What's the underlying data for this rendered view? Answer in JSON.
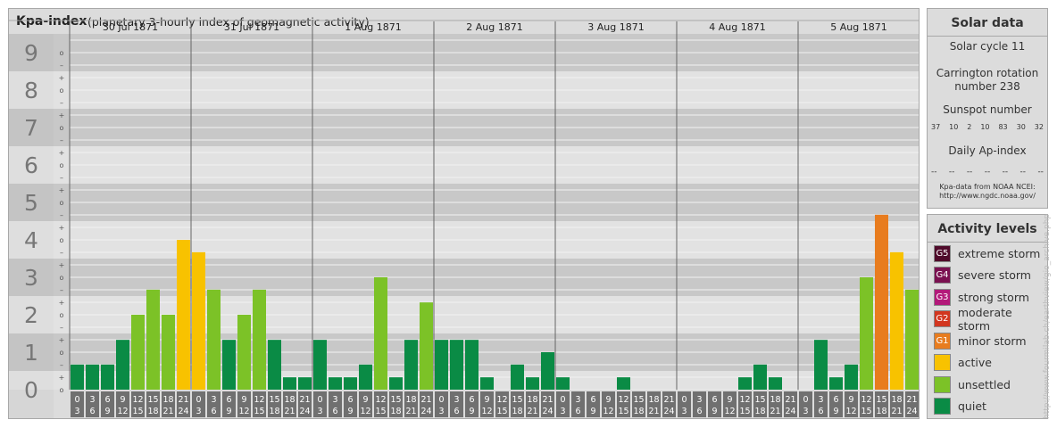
{
  "header": {
    "title": "Kpa-index",
    "subtitle": "(planetary 3-hourly index of geomagnetic activity)"
  },
  "solar": {
    "title": "Solar data",
    "cycle": "Solar cycle 11",
    "rotation_line1": "Carrington rotation",
    "rotation_line2": "number 238",
    "sunspot_label": "Sunspot number",
    "sunspots": [
      "37",
      "10",
      "2",
      "10",
      "83",
      "30",
      "32"
    ],
    "ap_label": "Daily Ap-index",
    "ap_values": [
      "--",
      "--",
      "--",
      "--",
      "--",
      "--",
      "--"
    ],
    "source_line1": "Kpa-data from NOAA NCEI:",
    "source_line2": "http://www.ngdc.noaa.gov/"
  },
  "levels": {
    "title": "Activity levels",
    "items": [
      {
        "badge": "G5",
        "label": "extreme storm",
        "color": "#4f0a2a"
      },
      {
        "badge": "G4",
        "label": "severe storm",
        "color": "#7a1050"
      },
      {
        "badge": "G3",
        "label": "strong storm",
        "color": "#b3197a"
      },
      {
        "badge": "G2",
        "label": "moderate storm",
        "color": "#d2361f"
      },
      {
        "badge": "G1",
        "label": "minor storm",
        "color": "#e87c1e"
      },
      {
        "badge": "",
        "label": "active",
        "color": "#f8c200"
      },
      {
        "badge": "",
        "label": "unsettled",
        "color": "#7cc227"
      },
      {
        "badge": "",
        "label": "quiet",
        "color": "#0a8b45"
      }
    ]
  },
  "credit": "http://www.fourmilab.ch/earthview/gio_archive.php",
  "chart_data": {
    "type": "bar",
    "y_axis_labels": [
      "0",
      "1",
      "2",
      "3",
      "4",
      "5",
      "6",
      "7",
      "8",
      "9"
    ],
    "y_minor_labels": [
      "–",
      "o",
      "+"
    ],
    "ylim": [
      0,
      9
    ],
    "days": [
      "30 Jul 1871",
      "31 Jul 1871",
      "1 Aug 1871",
      "2 Aug 1871",
      "3 Aug 1871",
      "4 Aug 1871",
      "5 Aug 1871"
    ],
    "slot_top_labels": [
      "0",
      "3",
      "6",
      "9",
      "12",
      "15",
      "18",
      "21"
    ],
    "slot_bottom_labels": [
      "3",
      "6",
      "9",
      "12",
      "15",
      "18",
      "21",
      "24"
    ],
    "values": [
      0.67,
      0.67,
      0.67,
      1.33,
      2.0,
      2.67,
      2.0,
      4.0,
      3.67,
      2.67,
      1.33,
      2.0,
      2.67,
      1.33,
      0.33,
      0.33,
      1.33,
      0.33,
      0.33,
      0.67,
      3.0,
      0.33,
      1.33,
      2.33,
      1.33,
      1.33,
      1.33,
      0.33,
      0.0,
      0.67,
      0.33,
      1.0,
      0.33,
      0.0,
      0.0,
      0.0,
      0.33,
      0.0,
      0.0,
      0.0,
      0.0,
      0.0,
      0.0,
      0.0,
      0.33,
      0.67,
      0.33,
      0.0,
      0.0,
      1.33,
      0.33,
      0.67,
      3.0,
      4.67,
      3.67,
      2.67
    ],
    "colors": {
      "quiet": "#0a8b45",
      "unsettled": "#7cc227",
      "active": "#f8c200",
      "minor": "#e87c1e"
    }
  }
}
